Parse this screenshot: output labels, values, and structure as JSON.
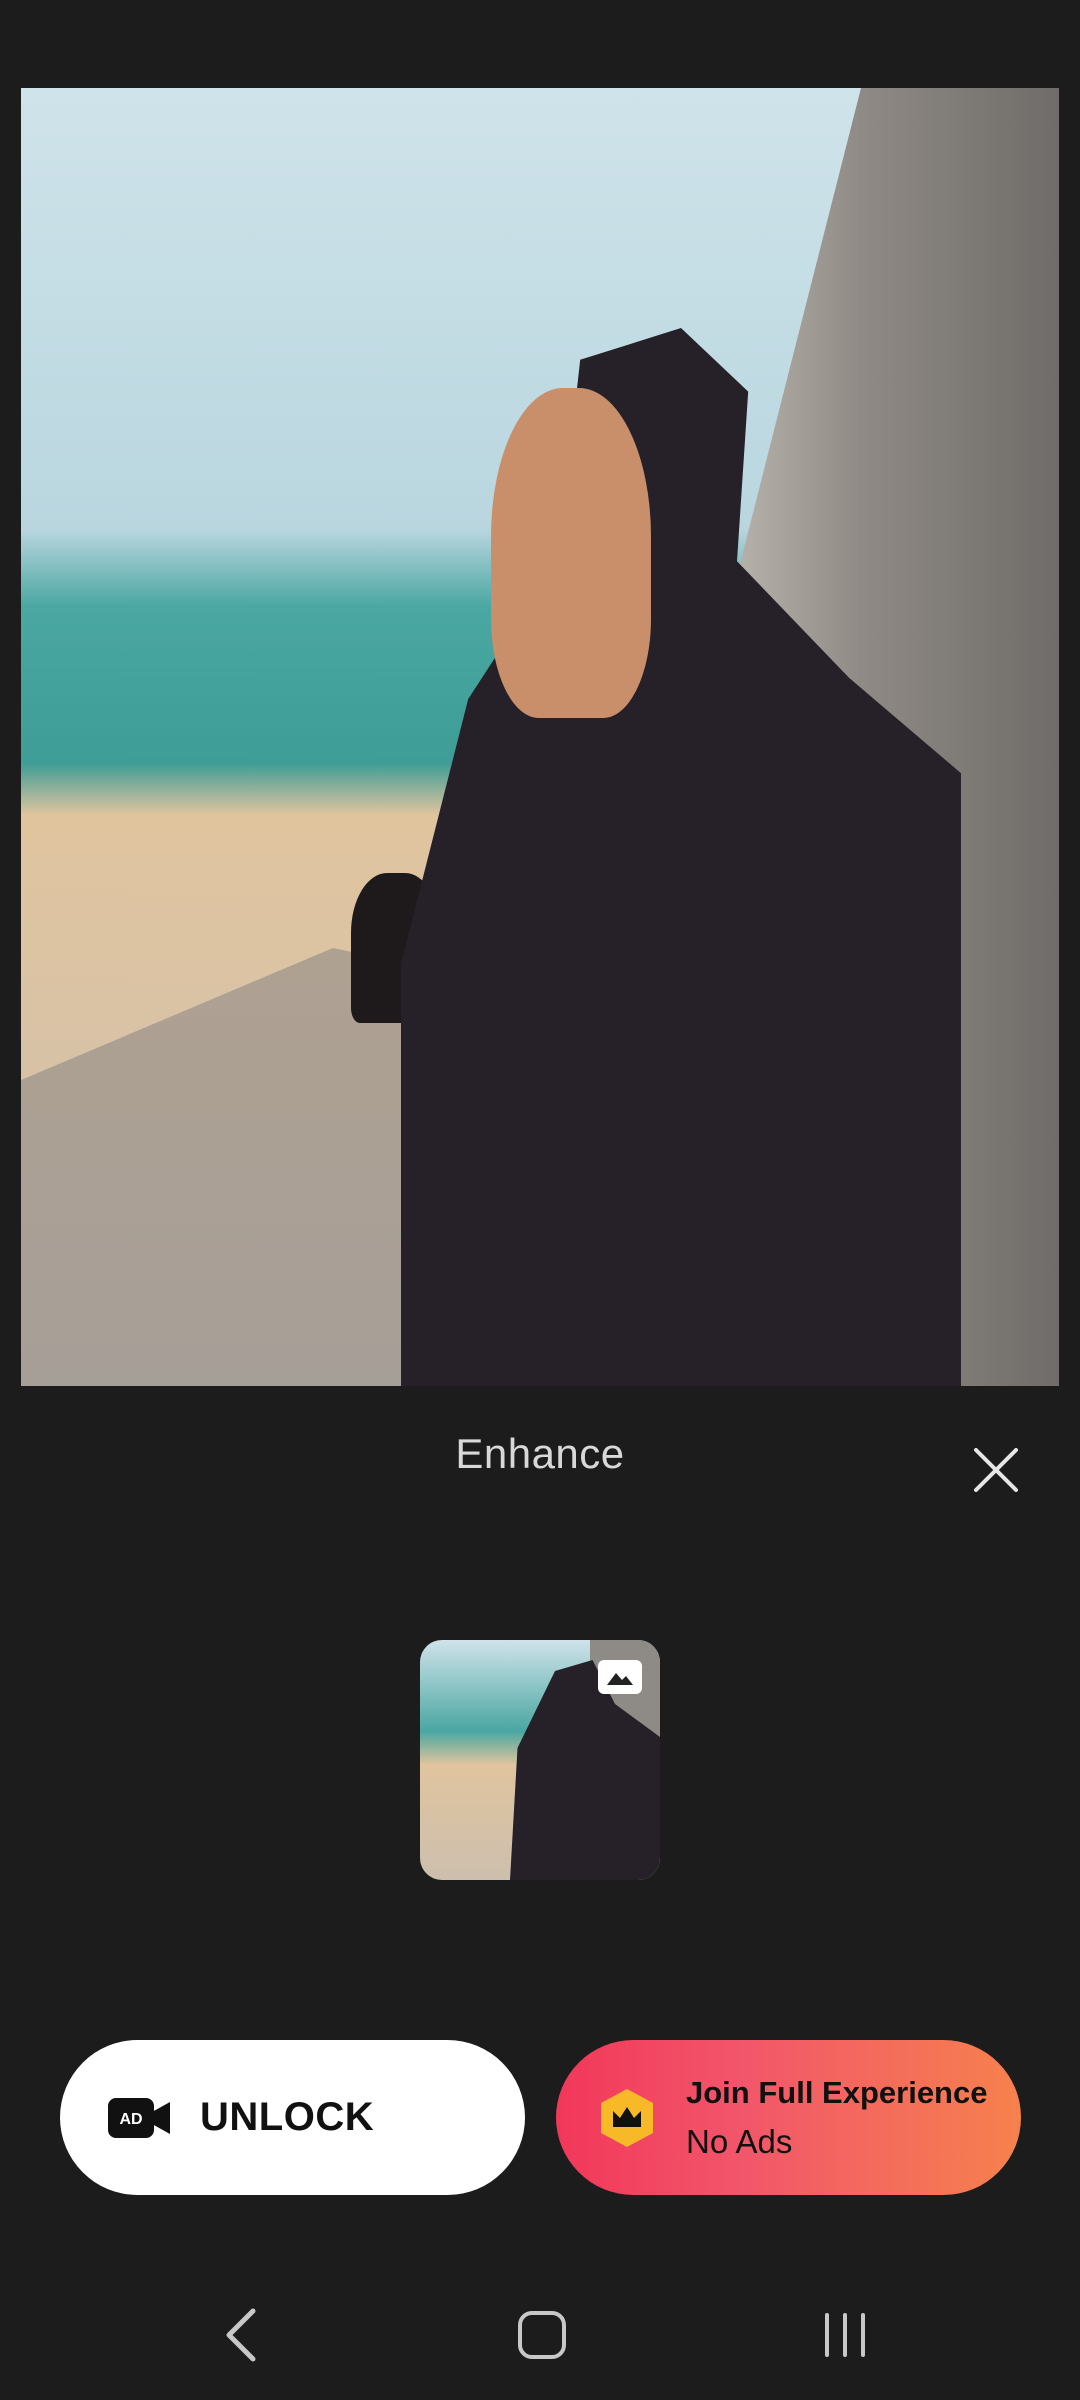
{
  "panel": {
    "title": "Enhance"
  },
  "buttons": {
    "unlock_label": "UNLOCK",
    "ad_badge_text": "AD",
    "join_title": "Join Full Experience",
    "join_subtitle": "No Ads"
  },
  "icons": {
    "close": "close-icon",
    "ad_video": "ad-video-icon",
    "crown": "crown-icon",
    "thumbnail_badge": "image-icon",
    "nav_back": "back-icon",
    "nav_home": "home-icon",
    "nav_recents": "recents-icon"
  },
  "colors": {
    "background": "#1c1c1c",
    "unlock_bg": "#ffffff",
    "join_gradient_start": "#f2375a",
    "join_gradient_end": "#f6814d",
    "crown_badge": "#f7b928"
  }
}
